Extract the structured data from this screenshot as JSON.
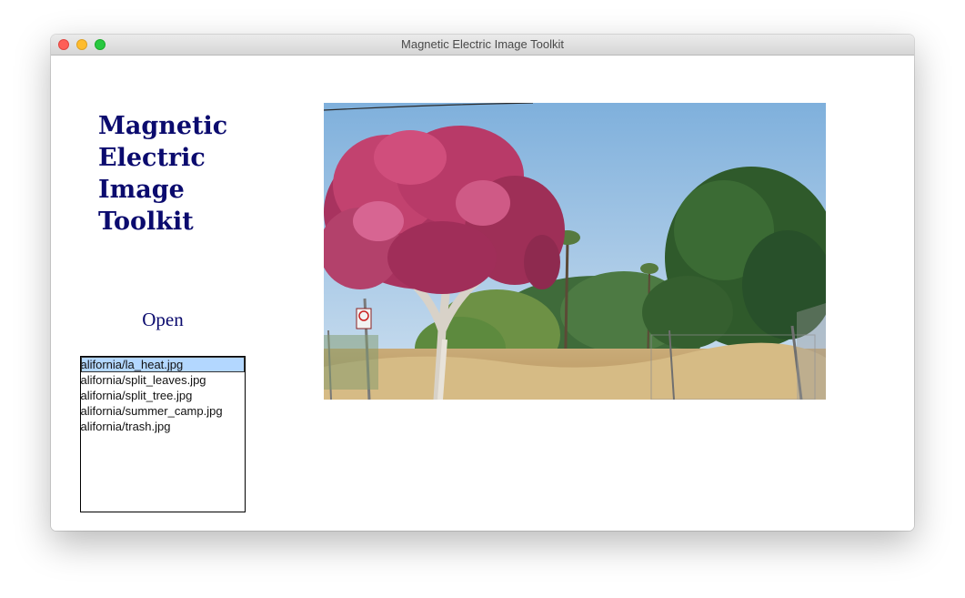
{
  "window": {
    "title": "Magnetic Electric Image Toolkit"
  },
  "heading": {
    "lines": [
      "Magnetic",
      "Electric",
      "Image",
      "Toolkit"
    ]
  },
  "open_button": {
    "label": "Open"
  },
  "file_list": {
    "selected_index": 0,
    "items": [
      "california/la_heat.jpg",
      "california/split_leaves.jpg",
      "california/split_tree.jpg",
      "california/summer_camp.jpg",
      "california/trash.jpg"
    ]
  },
  "colors": {
    "heading": "#0b0b6e",
    "selection": "#b3d7ff"
  }
}
